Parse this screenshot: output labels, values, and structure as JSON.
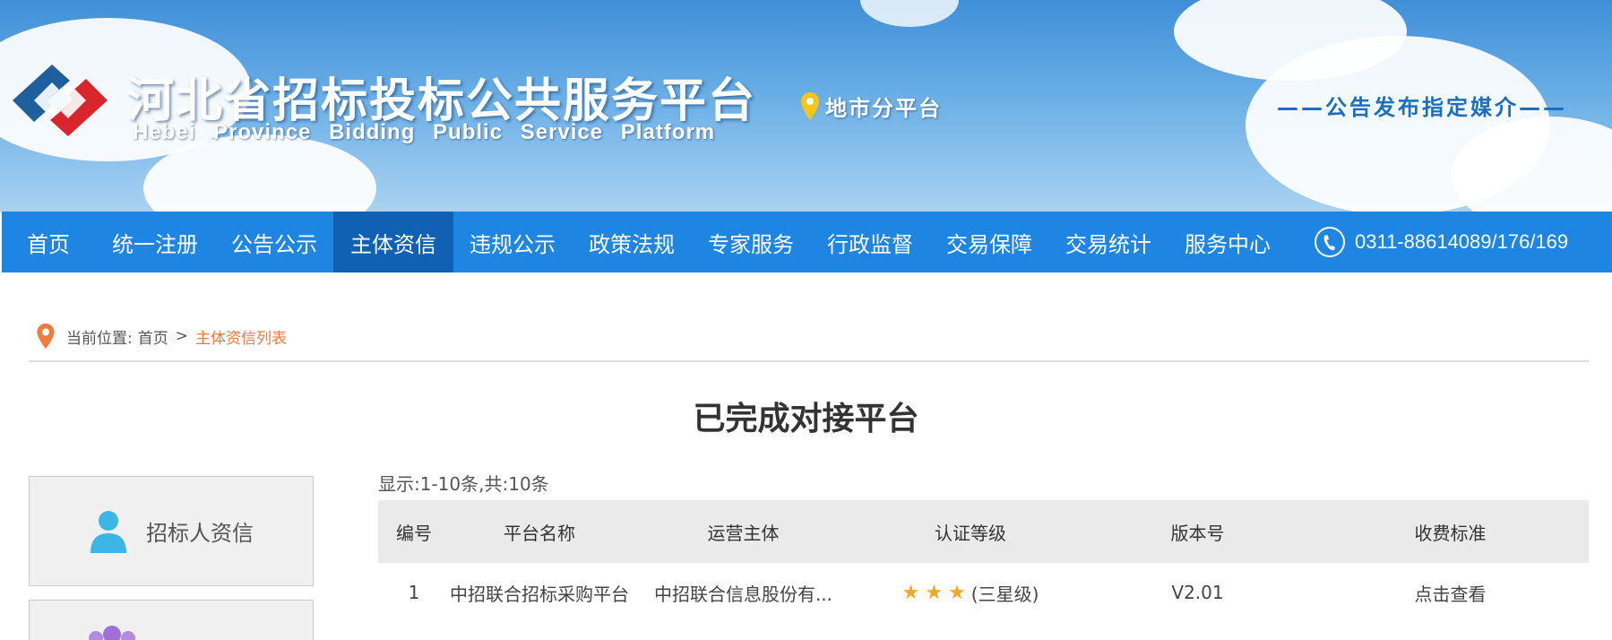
{
  "header": {
    "title_cn": "河北省招标投标公共服务平台",
    "title_en": "Hebei Province Bidding Public Service Platform",
    "city_platform": "地市分平台",
    "media_slogan": "——公告发布指定媒介——"
  },
  "nav": {
    "items": [
      {
        "label": "首页"
      },
      {
        "label": "统一注册"
      },
      {
        "label": "公告公示"
      },
      {
        "label": "主体资信"
      },
      {
        "label": "违规公示"
      },
      {
        "label": "政策法规"
      },
      {
        "label": "专家服务"
      },
      {
        "label": "行政监督"
      },
      {
        "label": "交易保障"
      },
      {
        "label": "交易统计"
      },
      {
        "label": "服务中心"
      }
    ],
    "active_index": 3,
    "phone": "0311-88614089/176/169"
  },
  "breadcrumb": {
    "prefix": "当前位置:",
    "home": "首页",
    "separator": ">",
    "current": "主体资信列表"
  },
  "page_title": "已完成对接平台",
  "sidebar": {
    "items": [
      {
        "label": "招标人资信",
        "icon": "person-icon"
      },
      {
        "label": "",
        "icon": "people-icon"
      }
    ]
  },
  "table": {
    "count_text": "显示:1-10条,共:10条",
    "headers": [
      "编号",
      "平台名称",
      "运营主体",
      "认证等级",
      "版本号",
      "收费标准"
    ],
    "rows": [
      {
        "id": "1",
        "name": "中招联合招标采购平台",
        "operator": "中招联合信息股份有...",
        "stars": 3,
        "level": "(三星级)",
        "version": "V2.01",
        "fee": "点击查看"
      }
    ]
  },
  "colors": {
    "nav_bg": "#1e86e2",
    "nav_active": "#1060b4",
    "breadcrumb_current": "#f27a3c",
    "star": "#f5a623",
    "media_text": "#1a6fbe"
  }
}
